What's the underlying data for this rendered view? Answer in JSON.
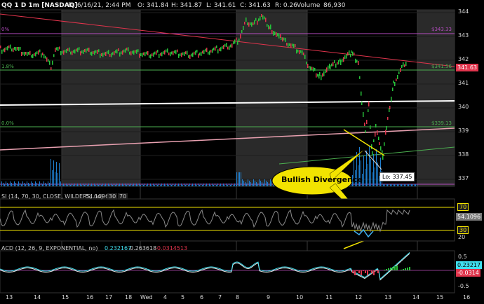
{
  "header": {
    "symbol": "QQ 1 D 1m [NASDAQ]",
    "date": "D: 6/16/21, 2:44 PM",
    "open": "O: 341.84",
    "high": "H: 341.87",
    "low": "L: 341.61",
    "close": "C: 341.63",
    "range": "R: 0.26",
    "volume_label": "Volume",
    "volume_value": "86,930"
  },
  "price_axis": [
    "344",
    "343",
    "342",
    "341",
    "340",
    "339",
    "338",
    "337"
  ],
  "price_tag": "341.63",
  "fib_levels": {
    "f1_left": "1.8%",
    "f1_right": "$341.56",
    "f2_left": "0.0%",
    "f2_right": "$339.13",
    "top_left": "0%",
    "top_right": "$343.33"
  },
  "low_marker": "Lo: 337.45",
  "annotation": "Bullish Divergence",
  "rsi": {
    "legend": "SI (14, 70, 30, CLOSE, WILDERS, no)",
    "value": "54.1096",
    "ob": "30",
    "os": "70",
    "axis": [
      "70",
      "54.1096",
      "30",
      "20"
    ]
  },
  "macd": {
    "legend": "ACD (12, 26, 9, EXPONENTIAL, no)",
    "v1": "0.232167",
    "v2": "0.263618",
    "v3": "-0.0314513",
    "axis": [
      "0.5",
      "0.23217",
      "-0.0314",
      "-0.5"
    ]
  },
  "time_axis": [
    "13",
    "14",
    "15",
    "16",
    "17",
    "18",
    "Wed",
    "4",
    "5",
    "6",
    "7",
    "8",
    "9",
    "10",
    "11",
    "12",
    "13",
    "14",
    "15",
    "16"
  ],
  "colors": {
    "fib": "#4caf50",
    "purple": "#b44cc0",
    "candle_up": "#27c23a",
    "candle_down": "#e0344c",
    "trend_red": "#e0344c",
    "price_tag_bg": "#e0344c",
    "rsi_line": "#8a8a8a",
    "macd_line": "#40e0f0",
    "annotation_bg": "#f2e300"
  }
}
